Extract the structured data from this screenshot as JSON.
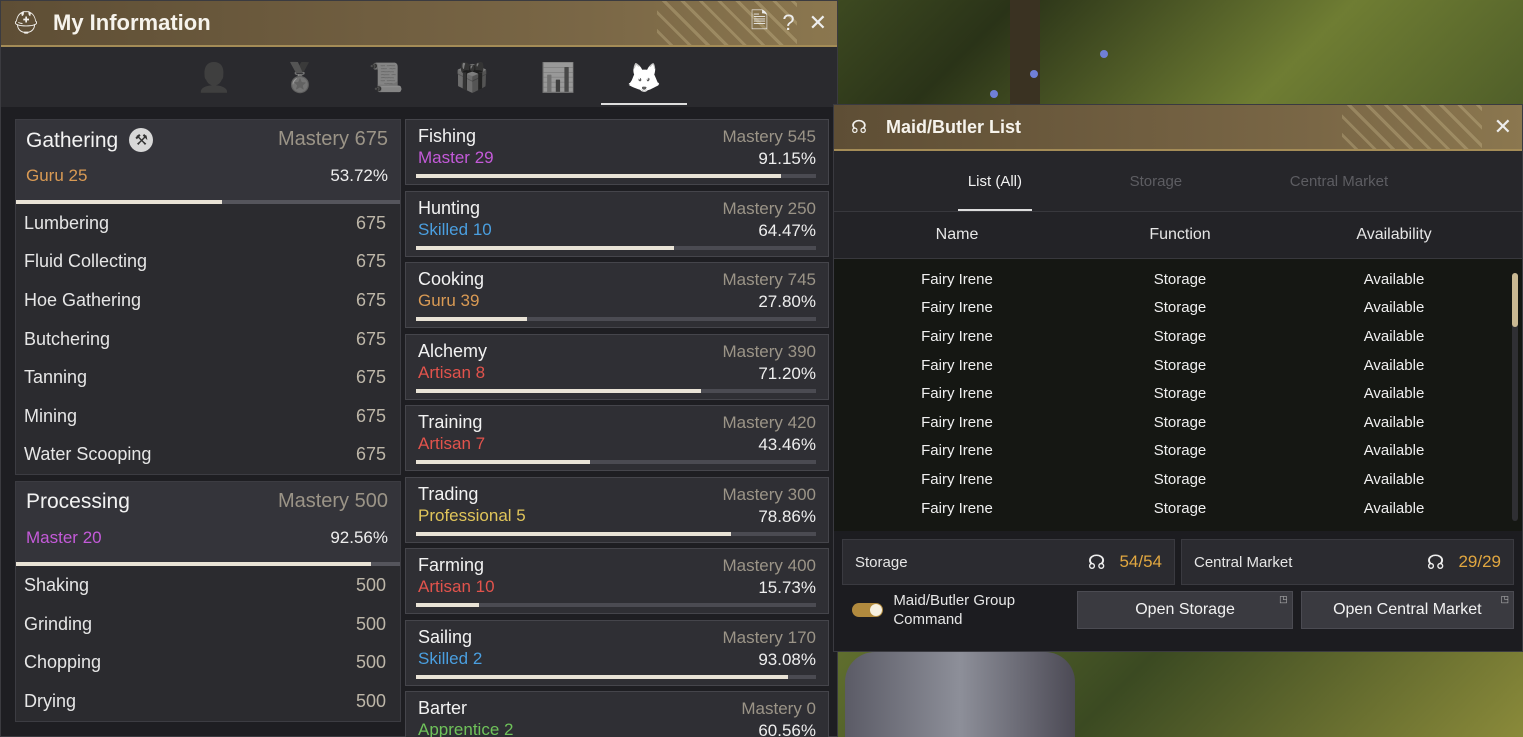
{
  "info_window": {
    "title": "My Information",
    "icons": {
      "title": "helmet-icon",
      "notes": "document-icon",
      "help": "?",
      "close": "✕"
    },
    "tabs": [
      {
        "icon": "profile-icon",
        "glyph": "👤"
      },
      {
        "icon": "medal-icon",
        "glyph": "🏅"
      },
      {
        "icon": "scroll-icon",
        "glyph": "📜"
      },
      {
        "icon": "gift-icon",
        "glyph": "🎁"
      },
      {
        "icon": "stats-icon",
        "glyph": "📊"
      },
      {
        "icon": "lifeskill-icon",
        "glyph": "🦊"
      }
    ],
    "gathering": {
      "title": "Gathering",
      "mastery_label": "Mastery",
      "mastery": "675",
      "rank": "Guru",
      "level": "25",
      "pct": "53.72%",
      "progress": 53.72,
      "subs": [
        {
          "name": "Lumbering",
          "value": "675"
        },
        {
          "name": "Fluid Collecting",
          "value": "675"
        },
        {
          "name": "Hoe Gathering",
          "value": "675"
        },
        {
          "name": "Butchering",
          "value": "675"
        },
        {
          "name": "Tanning",
          "value": "675"
        },
        {
          "name": "Mining",
          "value": "675"
        },
        {
          "name": "Water Scooping",
          "value": "675"
        }
      ]
    },
    "processing": {
      "title": "Processing",
      "mastery_label": "Mastery",
      "mastery": "500",
      "rank": "Master",
      "level": "20",
      "pct": "92.56%",
      "progress": 92.56,
      "subs": [
        {
          "name": "Shaking",
          "value": "500"
        },
        {
          "name": "Grinding",
          "value": "500"
        },
        {
          "name": "Chopping",
          "value": "500"
        },
        {
          "name": "Drying",
          "value": "500"
        }
      ]
    },
    "skills": [
      {
        "name": "Fishing",
        "mastery": "Mastery 545",
        "rank": "Master",
        "level": "29",
        "pct": "91.15%",
        "progress": 91.15,
        "cls": "c-master"
      },
      {
        "name": "Hunting",
        "mastery": "Mastery 250",
        "rank": "Skilled",
        "level": "10",
        "pct": "64.47%",
        "progress": 64.47,
        "cls": "c-skilled"
      },
      {
        "name": "Cooking",
        "mastery": "Mastery 745",
        "rank": "Guru",
        "level": "39",
        "pct": "27.80%",
        "progress": 27.8,
        "cls": "c-guru"
      },
      {
        "name": "Alchemy",
        "mastery": "Mastery 390",
        "rank": "Artisan",
        "level": "8",
        "pct": "71.20%",
        "progress": 71.2,
        "cls": "c-artisan"
      },
      {
        "name": "Training",
        "mastery": "Mastery 420",
        "rank": "Artisan",
        "level": "7",
        "pct": "43.46%",
        "progress": 43.46,
        "cls": "c-artisan"
      },
      {
        "name": "Trading",
        "mastery": "Mastery 300",
        "rank": "Professional",
        "level": "5",
        "pct": "78.86%",
        "progress": 78.86,
        "cls": "c-prof"
      },
      {
        "name": "Farming",
        "mastery": "Mastery 400",
        "rank": "Artisan",
        "level": "10",
        "pct": "15.73%",
        "progress": 15.73,
        "cls": "c-artisan"
      },
      {
        "name": "Sailing",
        "mastery": "Mastery 170",
        "rank": "Skilled",
        "level": "2",
        "pct": "93.08%",
        "progress": 93.08,
        "cls": "c-skilled"
      },
      {
        "name": "Barter",
        "mastery": "Mastery 0",
        "rank": "Apprentice",
        "level": "2",
        "pct": "60.56%",
        "progress": 60.56,
        "cls": "c-app"
      }
    ]
  },
  "maid_window": {
    "title": "Maid/Butler List",
    "tabs": [
      "List (All)",
      "Storage",
      "Central Market"
    ],
    "active_tab": 0,
    "columns": [
      "Name",
      "Function",
      "Availability"
    ],
    "rows": [
      [
        "Fairy Irene",
        "Storage",
        "Available"
      ],
      [
        "Fairy Irene",
        "Storage",
        "Available"
      ],
      [
        "Fairy Irene",
        "Storage",
        "Available"
      ],
      [
        "Fairy Irene",
        "Storage",
        "Available"
      ],
      [
        "Fairy Irene",
        "Storage",
        "Available"
      ],
      [
        "Fairy Irene",
        "Storage",
        "Available"
      ],
      [
        "Fairy Irene",
        "Storage",
        "Available"
      ],
      [
        "Fairy Irene",
        "Storage",
        "Available"
      ],
      [
        "Fairy Irene",
        "Storage",
        "Available"
      ]
    ],
    "storage_label": "Storage",
    "storage_count": "54/54",
    "market_label": "Central Market",
    "market_count": "29/29",
    "group_command": "Maid/Butler Group Command",
    "group_command_on": true,
    "open_storage": "Open Storage",
    "open_market": "Open Central Market"
  },
  "colors": {
    "accent": "#8b774f",
    "guru": "#d99a54",
    "master": "#c45ad9",
    "skilled": "#4a9fe0",
    "artisan": "#e2534c",
    "professional": "#e0c55a",
    "apprentice": "#6fc25a",
    "count": "#e1a740"
  }
}
